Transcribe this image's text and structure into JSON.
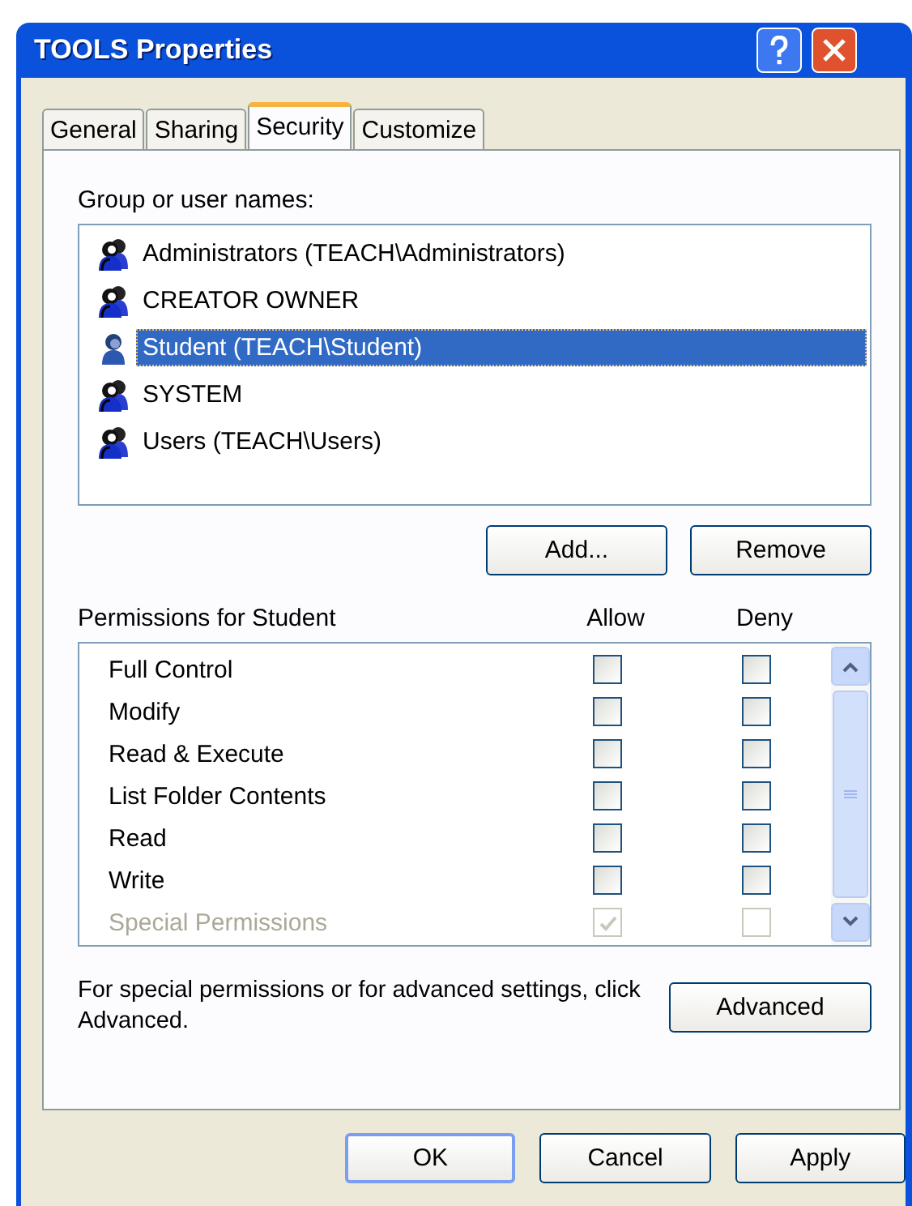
{
  "window": {
    "title": "TOOLS Properties"
  },
  "tabs": [
    {
      "label": "General",
      "selected": false
    },
    {
      "label": "Sharing",
      "selected": false
    },
    {
      "label": "Security",
      "selected": true
    },
    {
      "label": "Customize",
      "selected": false
    }
  ],
  "group_label": "Group or user names:",
  "users": [
    {
      "kind": "group",
      "name": "Administrators (TEACH\\Administrators)",
      "selected": false
    },
    {
      "kind": "group",
      "name": "CREATOR OWNER",
      "selected": false
    },
    {
      "kind": "user",
      "name": "Student (TEACH\\Student)",
      "selected": true
    },
    {
      "kind": "group",
      "name": "SYSTEM",
      "selected": false
    },
    {
      "kind": "group",
      "name": "Users (TEACH\\Users)",
      "selected": false
    }
  ],
  "user_buttons": [
    "Add...",
    "Remove"
  ],
  "permissions": {
    "label": "Permissions for Student",
    "columns": [
      "Allow",
      "Deny"
    ],
    "rows": [
      {
        "name": "Full Control",
        "allow": false,
        "deny": false,
        "disabled": false
      },
      {
        "name": "Modify",
        "allow": false,
        "deny": false,
        "disabled": false
      },
      {
        "name": "Read & Execute",
        "allow": false,
        "deny": false,
        "disabled": false
      },
      {
        "name": "List Folder Contents",
        "allow": false,
        "deny": false,
        "disabled": false
      },
      {
        "name": "Read",
        "allow": false,
        "deny": false,
        "disabled": false
      },
      {
        "name": "Write",
        "allow": false,
        "deny": false,
        "disabled": false
      },
      {
        "name": "Special Permissions",
        "allow": true,
        "deny": false,
        "disabled": true
      }
    ]
  },
  "advanced_note": "For special permissions or for advanced settings, click Advanced.",
  "advanced_button": "Advanced",
  "buttons": [
    "OK",
    "Cancel",
    "Apply"
  ]
}
